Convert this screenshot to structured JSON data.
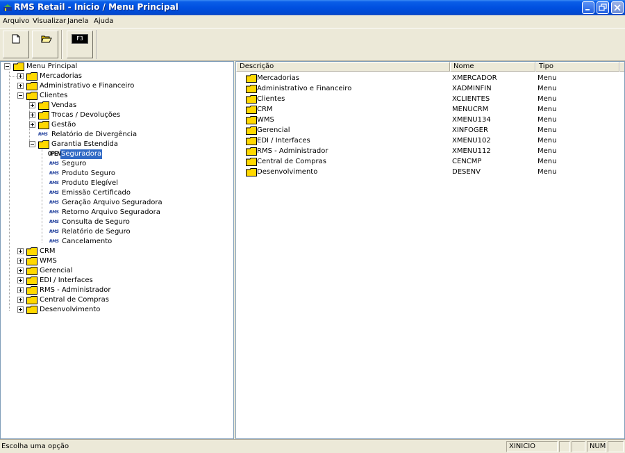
{
  "window": {
    "title": "RMS Retail - Inicio / Menu Principal"
  },
  "menubar": {
    "items": [
      "Arquivo",
      "Visualizar",
      "Janela",
      "Ajuda"
    ]
  },
  "toolbar": {
    "f3_label": "F3"
  },
  "tree": {
    "root": "Menu Principal",
    "mercadorias": "Mercadorias",
    "administrativo": "Administrativo e Financeiro",
    "clientes": "Clientes",
    "vendas": "Vendas",
    "trocas": "Trocas / Devoluções",
    "gestao": "Gestão",
    "relatorio_divergencia": "Relatório de Divergência",
    "garantia": "Garantia Estendida",
    "open_icon_text": "OPEN",
    "rms_icon_text": "RMS",
    "seguradora": "Seguradora",
    "seguro": "Seguro",
    "produto_seguro": "Produto Seguro",
    "produto_elegivel": "Produto Elegível",
    "emissao_certificado": "Emissão Certificado",
    "geracao_arquivo": "Geração Arquivo Seguradora",
    "retorno_arquivo": "Retorno Arquivo Seguradora",
    "consulta_seguro": "Consulta de Seguro",
    "relatorio_seguro": "Relatório de Seguro",
    "cancelamento": "Cancelamento",
    "crm": "CRM",
    "wms": "WMS",
    "gerencial": "Gerencial",
    "edi": "EDI / Interfaces",
    "rms_admin": "RMS - Administrador",
    "central_compras": "Central de Compras",
    "desenvolvimento": "Desenvolvimento"
  },
  "list": {
    "columns": [
      "Descrição",
      "Nome",
      "Tipo"
    ],
    "rows": [
      {
        "descricao": "Mercadorias",
        "nome": "XMERCADOR",
        "tipo": "Menu"
      },
      {
        "descricao": "Administrativo e Financeiro",
        "nome": "XADMINFIN",
        "tipo": "Menu"
      },
      {
        "descricao": "Clientes",
        "nome": "XCLIENTES",
        "tipo": "Menu"
      },
      {
        "descricao": "CRM",
        "nome": "MENUCRM",
        "tipo": "Menu"
      },
      {
        "descricao": "WMS",
        "nome": "XMENU134",
        "tipo": "Menu"
      },
      {
        "descricao": "Gerencial",
        "nome": "XINFOGER",
        "tipo": "Menu"
      },
      {
        "descricao": "EDI / Interfaces",
        "nome": "XMENU102",
        "tipo": "Menu"
      },
      {
        "descricao": "RMS - Administrador",
        "nome": "XMENU112",
        "tipo": "Menu"
      },
      {
        "descricao": "Central de Compras",
        "nome": "CENCMP",
        "tipo": "Menu"
      },
      {
        "descricao": "Desenvolvimento",
        "nome": "DESENV",
        "tipo": "Menu"
      }
    ]
  },
  "statusbar": {
    "message": "Escolha uma opção",
    "panel_1": "XINICIO",
    "panel_2": "",
    "panel_3": "",
    "panel_4": "NUM",
    "panel_5": ""
  },
  "colors": {
    "titlebar": "#0050e0",
    "selection": "#316ac5",
    "folder": "#ffd800"
  }
}
